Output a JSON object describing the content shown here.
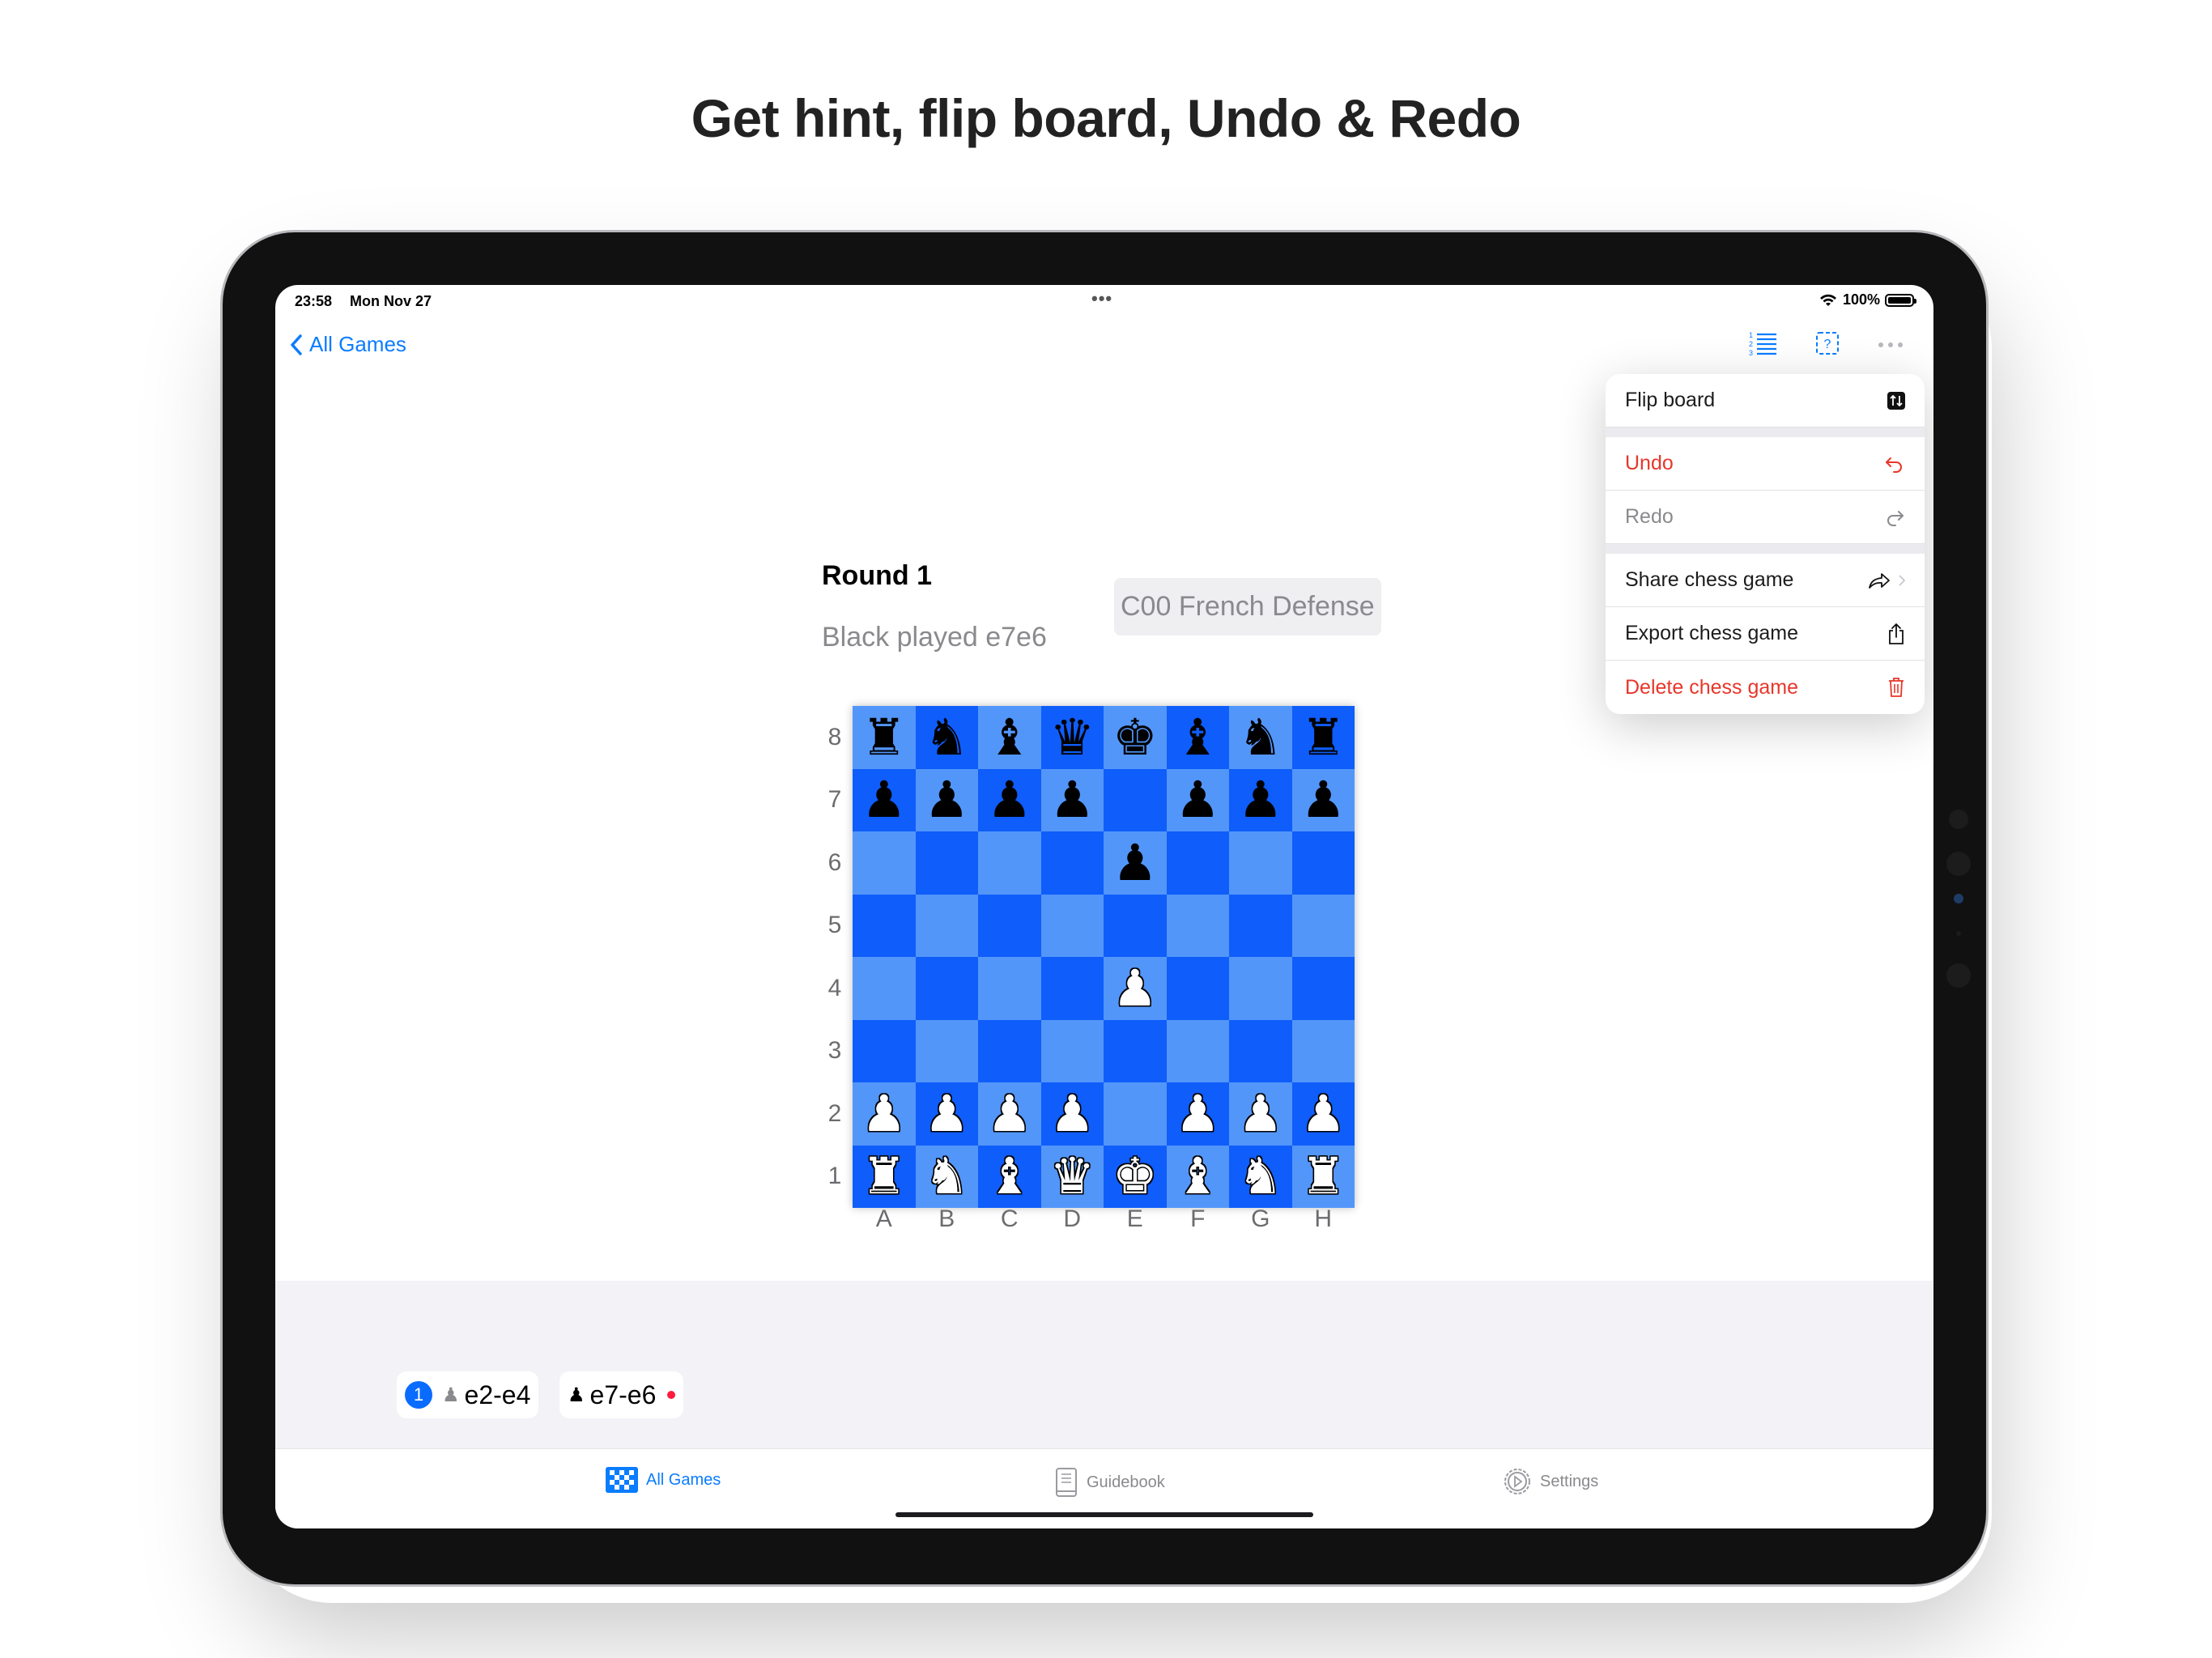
{
  "headline": "Get hint, flip board, Undo & Redo",
  "status_bar": {
    "time": "23:58",
    "date": "Mon Nov 27",
    "multitask_dots": "•••",
    "battery_percent": "100%",
    "battery_level": 1.0
  },
  "nav": {
    "back_label": "All Games",
    "icons": [
      "move-list-icon",
      "hint-icon",
      "more-icon"
    ]
  },
  "menu": {
    "flip_board": "Flip board",
    "undo": "Undo",
    "redo": "Redo",
    "share": "Share chess game",
    "export": "Export chess game",
    "delete": "Delete chess game"
  },
  "game": {
    "round": "Round 1",
    "last_move_text": "Black played e7e6",
    "opening": "C00 French Defense"
  },
  "board": {
    "ranks": [
      "8",
      "7",
      "6",
      "5",
      "4",
      "3",
      "2",
      "1"
    ],
    "files": [
      "A",
      "B",
      "C",
      "D",
      "E",
      "F",
      "G",
      "H"
    ],
    "position": [
      [
        "br",
        "bn",
        "bb",
        "bq",
        "bk",
        "bb",
        "bn",
        "br"
      ],
      [
        "bp",
        "bp",
        "bp",
        "bp",
        "",
        "bp",
        "bp",
        "bp"
      ],
      [
        "",
        "",
        "",
        "",
        "bp",
        "",
        "",
        ""
      ],
      [
        "",
        "",
        "",
        "",
        "",
        "",
        "",
        ""
      ],
      [
        "",
        "",
        "",
        "",
        "wp",
        "",
        "",
        ""
      ],
      [
        "",
        "",
        "",
        "",
        "",
        "",
        "",
        ""
      ],
      [
        "wp",
        "wp",
        "wp",
        "wp",
        "",
        "wp",
        "wp",
        "wp"
      ],
      [
        "wr",
        "wn",
        "wb",
        "wq",
        "wk",
        "wb",
        "wn",
        "wr"
      ]
    ]
  },
  "moves": {
    "number": "1",
    "white_icon": "♟",
    "white_move": "e2-e4",
    "black_icon": "♟",
    "black_move": "e7-e6"
  },
  "tab_bar": {
    "all_games": "All Games",
    "guidebook": "Guidebook",
    "settings": "Settings",
    "active_color": "#0a7cff",
    "inactive_color": "#8a8a8e"
  },
  "colors": {
    "accent": "#0a7cff",
    "destructive": "#e8362a",
    "board_light": "#5396fa",
    "board_dark": "#0f5dfa"
  }
}
